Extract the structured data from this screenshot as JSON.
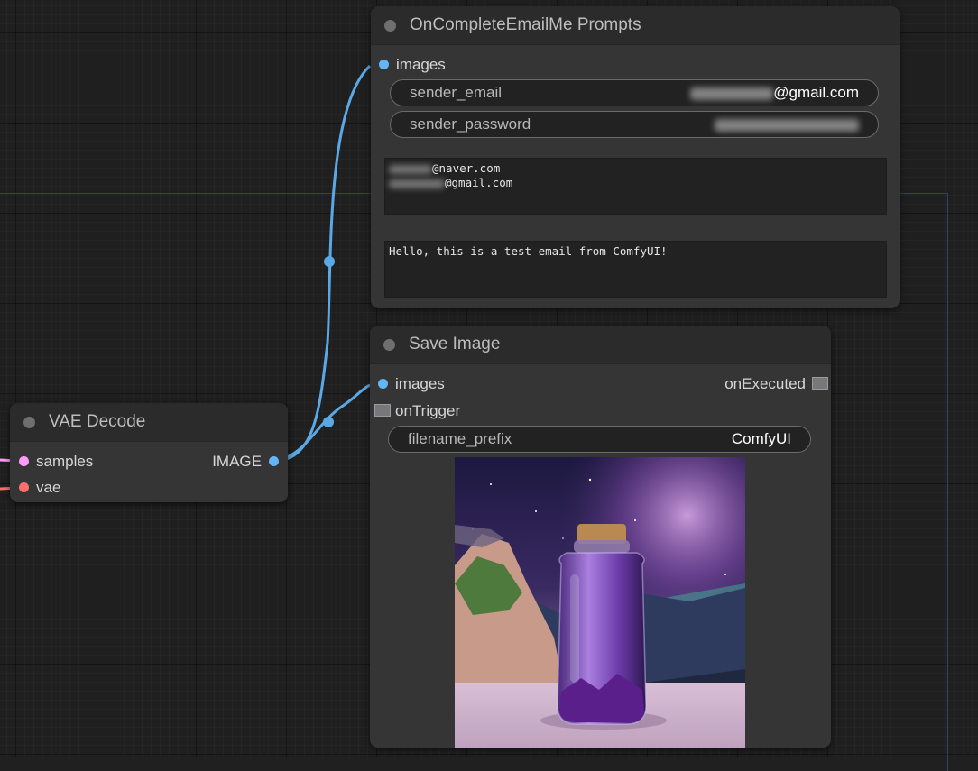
{
  "colors": {
    "link_image": "#5aa9e6",
    "pin_samples": "#ff9cf9",
    "pin_vae": "#ff6e6e",
    "pin_image": "#64b5f6"
  },
  "email_node": {
    "title": "OnCompleteEmailMe Prompts",
    "input_images": "images",
    "sender_email": {
      "label": "sender_email",
      "value_suffix": "@gmail.com"
    },
    "sender_password": {
      "label": "sender_password"
    },
    "recipients": [
      "@naver.com",
      "@gmail.com"
    ],
    "message": "Hello, this is a test email from ComfyUI!"
  },
  "save_node": {
    "title": "Save Image",
    "input_images": "images",
    "output_on_executed": "onExecuted",
    "input_on_trigger": "onTrigger",
    "filename_prefix": {
      "label": "filename_prefix",
      "value": "ComfyUI"
    },
    "preview_icon": "generated-image-bottle-galaxy"
  },
  "vae_node": {
    "title": "VAE Decode",
    "input_samples": "samples",
    "input_vae": "vae",
    "output_image": "IMAGE"
  }
}
